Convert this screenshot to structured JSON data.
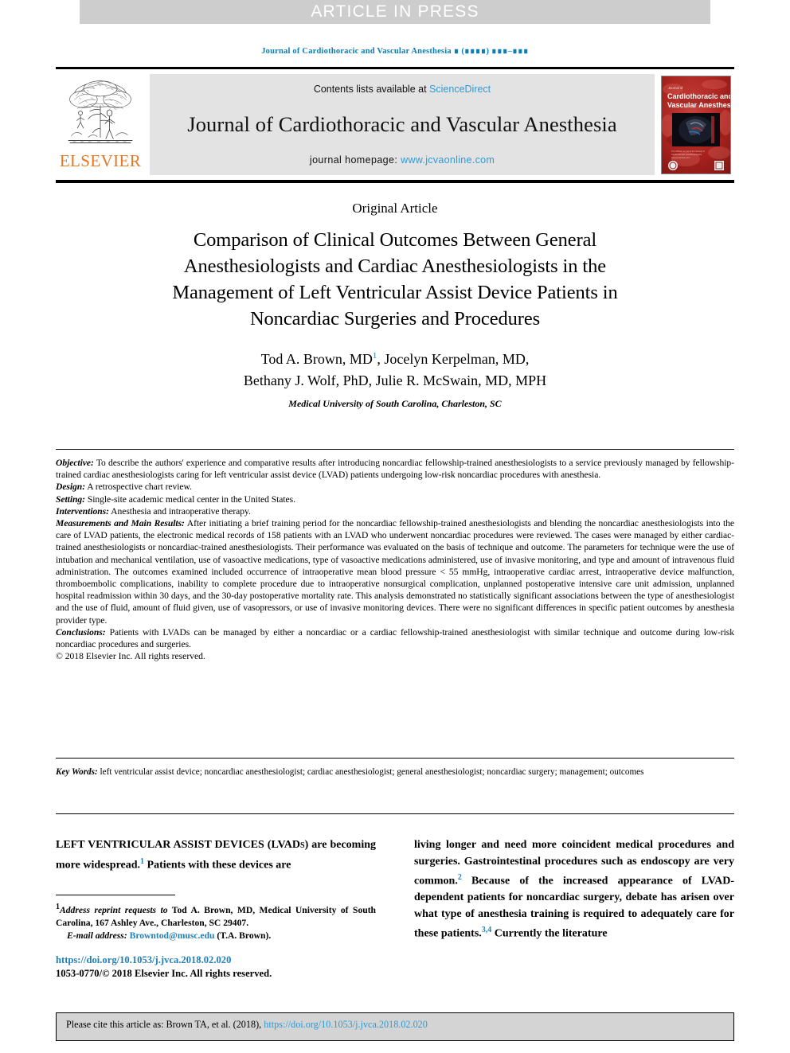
{
  "banner": {
    "label": "ARTICLE IN PRESS"
  },
  "running_citation": {
    "text": "Journal of Cardiothoracic and Vascular Anesthesia ∎ (∎∎∎∎) ∎∎∎–∎∎∎"
  },
  "masthead": {
    "publisher_name": "ELSEVIER",
    "publisher_logo_icon": "elsevier-tree-icon",
    "contents_prefix": "Contents lists available at",
    "contents_link": "ScienceDirect",
    "journal_title": "Journal of Cardiothoracic and Vascular Anesthesia",
    "homepage_prefix": "journal homepage:",
    "homepage_link": "www.jcvaonline.com",
    "cover_icon": "journal-cover-thumbnail",
    "cover_title_line1": "Cardiothoracic and",
    "cover_title_line2": "Vascular Anesthesia",
    "cover_kicker": "Journal of"
  },
  "article": {
    "type_label": "Original Article",
    "title": "Comparison of Clinical Outcomes Between General Anesthesiologists and Cardiac Anesthesiologists in the Management of Left Ventricular Assist Device Patients in Noncardiac Surgeries and Procedures",
    "authors_line1_a": "Tod A. Brown, MD",
    "authors_marker": "1",
    "authors_line1_b": ", Jocelyn Kerpelman, MD,",
    "authors_line2": "Bethany J. Wolf, PhD, Julie R. McSwain, MD, MPH",
    "affiliation": "Medical University of South Carolina, Charleston, SC"
  },
  "abstract": {
    "sections": [
      {
        "label": "Objective:",
        "text": " To describe the authors' experience and comparative results after introducing noncardiac fellowship-trained anesthesiologists to a service previously managed by fellowship-trained cardiac anesthesiologists caring for left ventricular assist device (LVAD) patients undergoing low-risk noncardiac procedures with anesthesia."
      },
      {
        "label": "Design:",
        "text": " A retrospective chart review."
      },
      {
        "label": "Setting:",
        "text": " Single-site academic medical center in the United States."
      },
      {
        "label": "Interventions:",
        "text": " Anesthesia and intraoperative therapy."
      },
      {
        "label": "Measurements and Main Results:",
        "text": " After initiating a brief training period for the noncardiac fellowship-trained anesthesiologists and blending the noncardiac anesthesiologists into the care of LVAD patients, the electronic medical records of 158 patients with an LVAD who underwent noncardiac procedures were reviewed. The cases were managed by either cardiac-trained anesthesiologists or noncardiac-trained anesthesiologists. Their performance was evaluated on the basis of technique and outcome. The parameters for technique were the use of intubation and mechanical ventilation, use of vasoactive medications, type of vasoactive medications administered, use of invasive monitoring, and type and amount of intravenous fluid administration. The outcomes examined included occurrence of intraoperative mean blood pressure < 55 mmHg, intraoperative cardiac arrest, intraoperative device malfunction, thromboembolic complications, inability to complete procedure due to intraoperative nonsurgical complication, unplanned postoperative intensive care unit admission, unplanned hospital readmission within 30 days, and the 30-day postoperative mortality rate. This analysis demonstrated no statistically significant associations between the type of anesthesiologist and the use of fluid, amount of fluid given, use of vasopressors, or use of invasive monitoring devices. There were no significant differences in specific patient outcomes by anesthesia provider type."
      },
      {
        "label": "Conclusions:",
        "text": " Patients with LVADs can be managed by either a noncardiac or a cardiac fellowship-trained anesthesiologist with similar technique and outcome during low-risk noncardiac procedures and surgeries."
      }
    ],
    "copyright": "© 2018 Elsevier Inc. All rights reserved."
  },
  "keywords": {
    "label": "Key Words:",
    "text": " left ventricular assist device; noncardiac anesthesiologist; cardiac anesthesiologist; general anesthesiologist; noncardiac surgery; management; outcomes"
  },
  "body": {
    "left_column": {
      "opening_caps": "LEFT VENTRICULAR ASSIST DEVICES (LVADs)",
      "text_after_caps": " are becoming more widespread.",
      "ref1": "1",
      "text_tail": " Patients with these devices are"
    },
    "right_column": {
      "text_a": "living longer and need more coincident medical procedures and surgeries. Gastrointestinal procedures such as endoscopy are very common.",
      "ref2": "2",
      "text_b": " Because of the increased appearance of LVAD-dependent patients for noncardiac surgery, debate has arisen over what type of anesthesia training is required to adequately care for these patients.",
      "ref34": "3,4",
      "text_c": " Currently the literature"
    }
  },
  "footnotes": {
    "marker": "1",
    "address_label": "Address reprint requests to",
    "address_text": " Tod A. Brown, MD, Medical University of South Carolina, 167 Ashley Ave., Charleston, SC 29407.",
    "email_label": "E-mail address:",
    "email_link": "Browntod@musc.edu",
    "email_suffix": " (T.A. Brown)."
  },
  "publication": {
    "doi_url": "https://doi.org/10.1053/j.jvca.2018.02.020",
    "issn_copyright": "1053-0770/© 2018 Elsevier Inc. All rights reserved."
  },
  "cite_footer": {
    "prefix": "Please cite this article as: Brown TA, et al. (2018),",
    "link": "https://doi.org/10.1053/j.jvca.2018.02.020"
  }
}
